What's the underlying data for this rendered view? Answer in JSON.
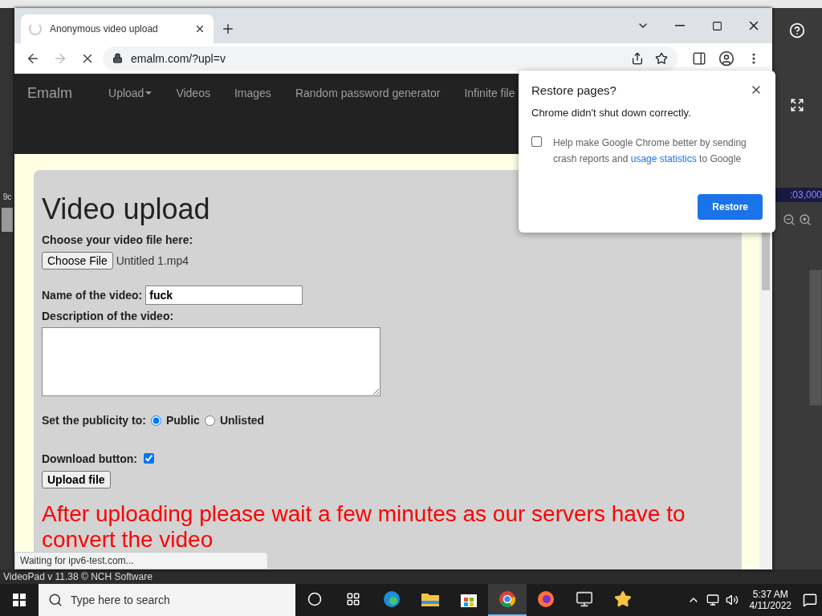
{
  "background_app": {
    "left_label": "9c",
    "timecode": ":03,000",
    "status_text": "VideoPad v 11.38 © NCH Software"
  },
  "browser": {
    "tabs": [
      {
        "title": "Anonymous video upload",
        "selected": true,
        "loading": true
      }
    ],
    "nav_buttons": [
      {
        "kind": "back",
        "disabled": false
      },
      {
        "kind": "forward",
        "disabled": true
      },
      {
        "kind": "stop",
        "disabled": false
      }
    ],
    "address": "emalm.com/?upl=v",
    "status_bubble": "Waiting for ipv6-test.com..."
  },
  "site": {
    "brand": "Emalm",
    "nav": [
      {
        "label": "Upload",
        "dropdown": true
      },
      {
        "label": "Videos",
        "dropdown": false
      },
      {
        "label": "Images",
        "dropdown": false
      },
      {
        "label": "Random password generator",
        "dropdown": false
      },
      {
        "label": "Infinite file",
        "dropdown": false
      }
    ]
  },
  "form": {
    "title": "Video upload",
    "file_label": "Choose your video file here:",
    "file_button": "Choose File",
    "file_name": "Untitled 1.mp4",
    "name_label": "Name of the video:",
    "name_value": "fuck",
    "description_label": "Description of the video:",
    "publicity_label": "Set the publicity to:",
    "publicity_options": [
      {
        "label": "Public",
        "selected": true
      },
      {
        "label": "Unlisted",
        "selected": false
      }
    ],
    "download_label": "Download button:",
    "download_checked": true,
    "submit": "Upload file",
    "notice": "After uploading please wait a few minutes as our servers have to convert the video"
  },
  "restore_dialog": {
    "title": "Restore pages?",
    "message": "Chrome didn't shut down correctly.",
    "checked": false,
    "checkbox_before": "Help make Google Chrome better by sending crash reports and ",
    "checkbox_link": "usage statistics",
    "checkbox_after": " to Google",
    "button": "Restore"
  },
  "taskbar": {
    "search_placeholder": "Type here to search",
    "apps": [
      {
        "kind": "edge",
        "selected": false
      },
      {
        "kind": "folder",
        "selected": false
      },
      {
        "kind": "store",
        "selected": false
      },
      {
        "kind": "chrome",
        "selected": true
      },
      {
        "kind": "firefox",
        "selected": false
      },
      {
        "kind": "monitor",
        "selected": false
      },
      {
        "kind": "star",
        "selected": false
      }
    ],
    "time": "5:37 AM",
    "date": "4/11/2022"
  }
}
